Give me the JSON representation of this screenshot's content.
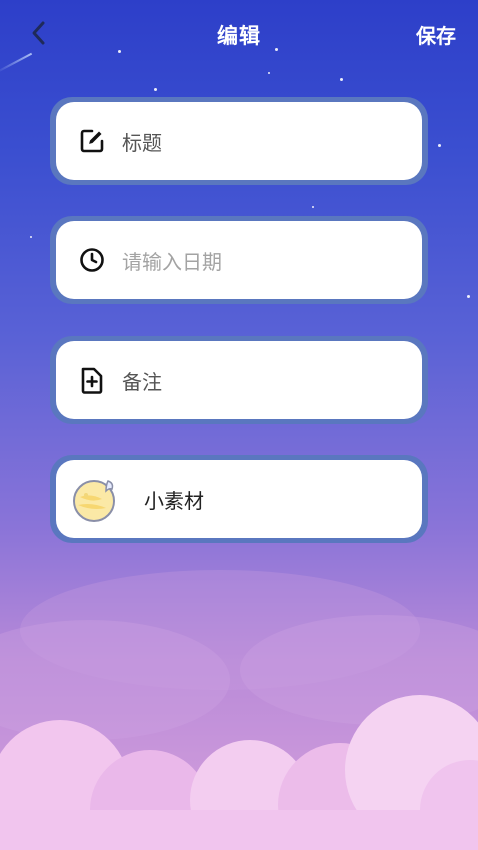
{
  "header": {
    "title": "编辑",
    "save_label": "保存"
  },
  "fields": {
    "title": {
      "label": "标题",
      "icon": "edit-icon"
    },
    "date": {
      "placeholder": "请输入日期",
      "icon": "clock-icon"
    },
    "note": {
      "label": "备注",
      "icon": "file-add-icon"
    },
    "sticker": {
      "label": "小素材",
      "icon": "moon-sticker-icon"
    }
  },
  "colors": {
    "sky_top": "#2d3fc9",
    "sky_bottom": "#d7a2dd",
    "card_border": "#5a77bf",
    "card_bg": "#ffffff"
  }
}
